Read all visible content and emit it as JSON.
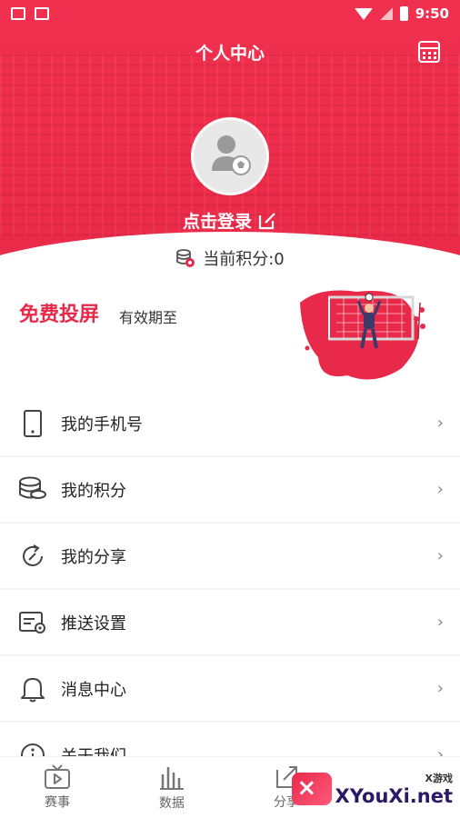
{
  "status_bar": {
    "time": "9:50"
  },
  "header": {
    "title": "个人中心",
    "calendar_icon": "calendar-icon"
  },
  "profile": {
    "login_label": "点击登录",
    "points_label": "当前积分:0"
  },
  "promo": {
    "title": "免费投屏",
    "subtitle": "有效期至"
  },
  "menu": {
    "items": [
      {
        "label": "我的手机号",
        "icon": "phone-icon"
      },
      {
        "label": "我的积分",
        "icon": "coins-icon"
      },
      {
        "label": "我的分享",
        "icon": "share-refresh-icon"
      },
      {
        "label": "推送设置",
        "icon": "push-settings-icon"
      },
      {
        "label": "消息中心",
        "icon": "bell-icon"
      },
      {
        "label": "关于我们",
        "icon": "info-icon"
      }
    ],
    "chevron": "›"
  },
  "bottom_nav": {
    "items": [
      {
        "label": "赛事",
        "icon": "tv-icon"
      },
      {
        "label": "数据",
        "icon": "bar-chart-icon"
      },
      {
        "label": "分享",
        "icon": "share-edit-icon"
      }
    ]
  },
  "watermark": {
    "small": "X游戏",
    "big": "XYouXi.net"
  },
  "colors": {
    "primary": "#e8294a",
    "header_bg": "#ee2e4c"
  }
}
